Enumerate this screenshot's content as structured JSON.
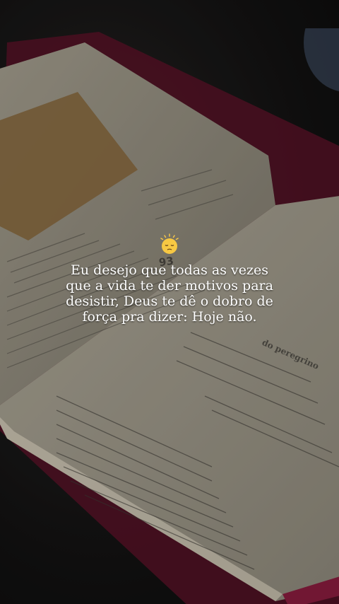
{
  "caption": {
    "emoji": "pensive-face-with-sparkle",
    "lines": [
      "Eu desejo que todas as vezes",
      "que a vida te der motivos para",
      "desistir, Deus te dê o dobro de",
      "força pra dizer: Hoje não."
    ]
  },
  "book_page": {
    "page_number": "93",
    "heading_fragment": "do peregrino"
  },
  "colors": {
    "text": "#ffffff",
    "page": "#d8d1bf",
    "cover_edge": "#8a1d3f",
    "sticky_note": "#b88d54"
  }
}
